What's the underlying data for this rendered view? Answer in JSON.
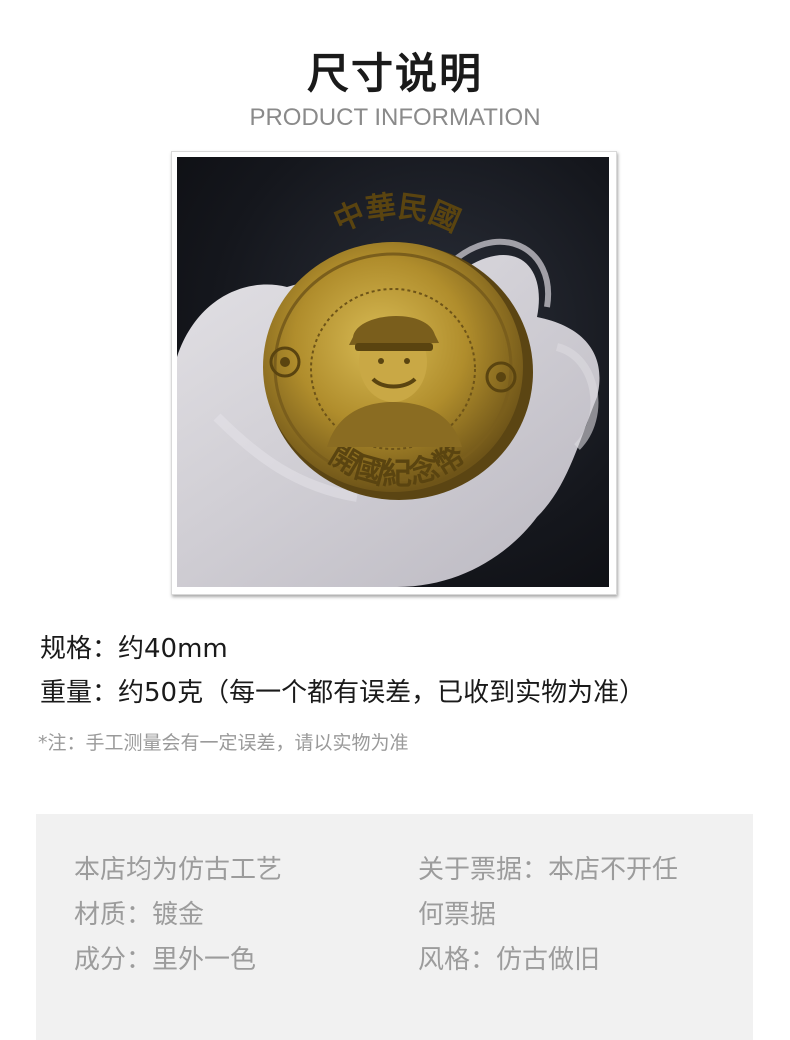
{
  "header": {
    "title": "尺寸说明",
    "subtitle": "PRODUCT INFORMATION"
  },
  "photo": {
    "subject": "coin-in-gloved-hand",
    "coin_top_text": "中華民國",
    "coin_bottom_text": "開國紀念幣"
  },
  "specs": {
    "size": "规格：约40mm",
    "weight": "重量：约50克（每一个都有误差，已收到实物为准）",
    "note": "*注：手工测量会有一定误差，请以实物为准"
  },
  "info": {
    "left_lines": [
      "本店均为仿古工艺",
      "材质：镀金",
      "成分：里外一色"
    ],
    "right_lines": [
      "关于票据：本店不开任",
      "何票据",
      "风格：仿古做旧"
    ]
  },
  "colors": {
    "title": "#1a1a1a",
    "subtitle": "#8a8a8a",
    "note": "#9a9a9a",
    "info_bg": "#f1f1f1",
    "info_text": "#9c9c9c",
    "coin_gold": "#b8962e"
  }
}
